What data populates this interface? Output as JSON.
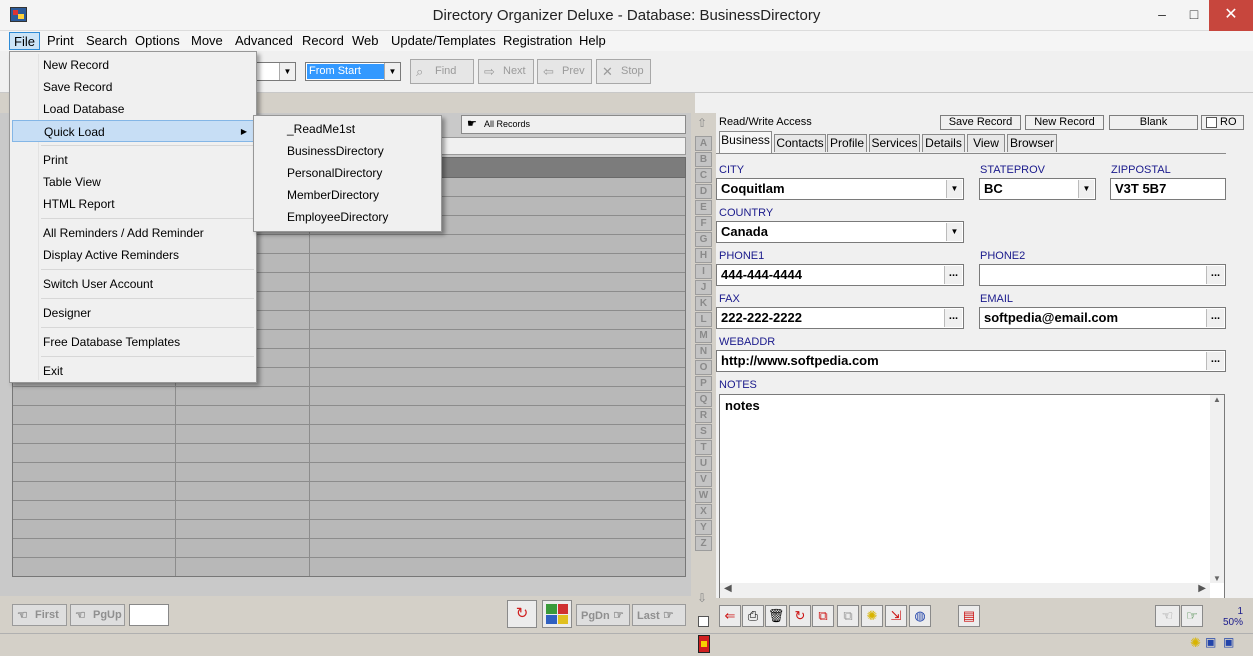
{
  "window": {
    "title": "Directory Organizer Deluxe - Database: BusinessDirectory",
    "minimize": "‒",
    "maximize": "□",
    "close": "✕"
  },
  "menubar": [
    "File",
    "Print",
    "Search",
    "Options",
    "Move",
    "Advanced",
    "Record",
    "Web",
    "Update/Templates",
    "Registration",
    "Help"
  ],
  "file_menu": {
    "items": [
      "New Record",
      "Save Record",
      "Load Database",
      "Quick Load",
      "Print",
      "Table View",
      "HTML Report",
      "All Reminders / Add Reminder",
      "Display Active Reminders",
      "Switch User Account",
      "Designer",
      "Free Database Templates",
      "Exit"
    ],
    "submenu_arrow": "▶"
  },
  "quick_load_submenu": [
    "_ReadMe1st",
    "BusinessDirectory",
    "PersonalDirectory",
    "MemberDirectory",
    "EmployeeDirectory"
  ],
  "toolbar": {
    "search_scope": "From Start",
    "find": "Find",
    "next": "Next",
    "prev": "Prev",
    "stop": "Stop"
  },
  "left_panel": {
    "all_records": "All Records"
  },
  "navigation": {
    "first": "First",
    "pgup": "PgUp",
    "pgdn": "PgDn",
    "last": "Last"
  },
  "alphabet": [
    "A",
    "B",
    "C",
    "D",
    "E",
    "F",
    "G",
    "H",
    "I",
    "J",
    "K",
    "L",
    "M",
    "N",
    "O",
    "P",
    "Q",
    "R",
    "S",
    "T",
    "U",
    "V",
    "W",
    "X",
    "Y",
    "Z"
  ],
  "record_panel": {
    "access": "Read/Write Access",
    "save_record": "Save Record",
    "new_record": "New Record",
    "blank": "Blank",
    "ro": "RO",
    "tabs": [
      "Business",
      "Contacts",
      "Profile",
      "Services",
      "Details",
      "View",
      "Browser"
    ]
  },
  "fields": {
    "city": {
      "label": "CITY",
      "value": "Coquitlam"
    },
    "stateprov": {
      "label": "STATEPROV",
      "value": "BC"
    },
    "zippostal": {
      "label": "ZIPPOSTAL",
      "value": "V3T 5B7"
    },
    "country": {
      "label": "COUNTRY",
      "value": "Canada"
    },
    "phone1": {
      "label": "PHONE1",
      "value": "444-444-4444"
    },
    "phone2": {
      "label": "PHONE2",
      "value": ""
    },
    "fax": {
      "label": "FAX",
      "value": "222-222-2222"
    },
    "email": {
      "label": "EMAIL",
      "value": "softpedia@email.com"
    },
    "webaddr": {
      "label": "WEBADDR",
      "value": "http://www.softpedia.com"
    },
    "notes": {
      "label": "NOTES",
      "value": "notes"
    }
  },
  "ellipsis": "...",
  "zoom": {
    "count": "1",
    "percent": "50%"
  },
  "colors": {
    "accent": "#2e8bd6",
    "close": "#c7463d",
    "label": "#1a1a8c"
  }
}
